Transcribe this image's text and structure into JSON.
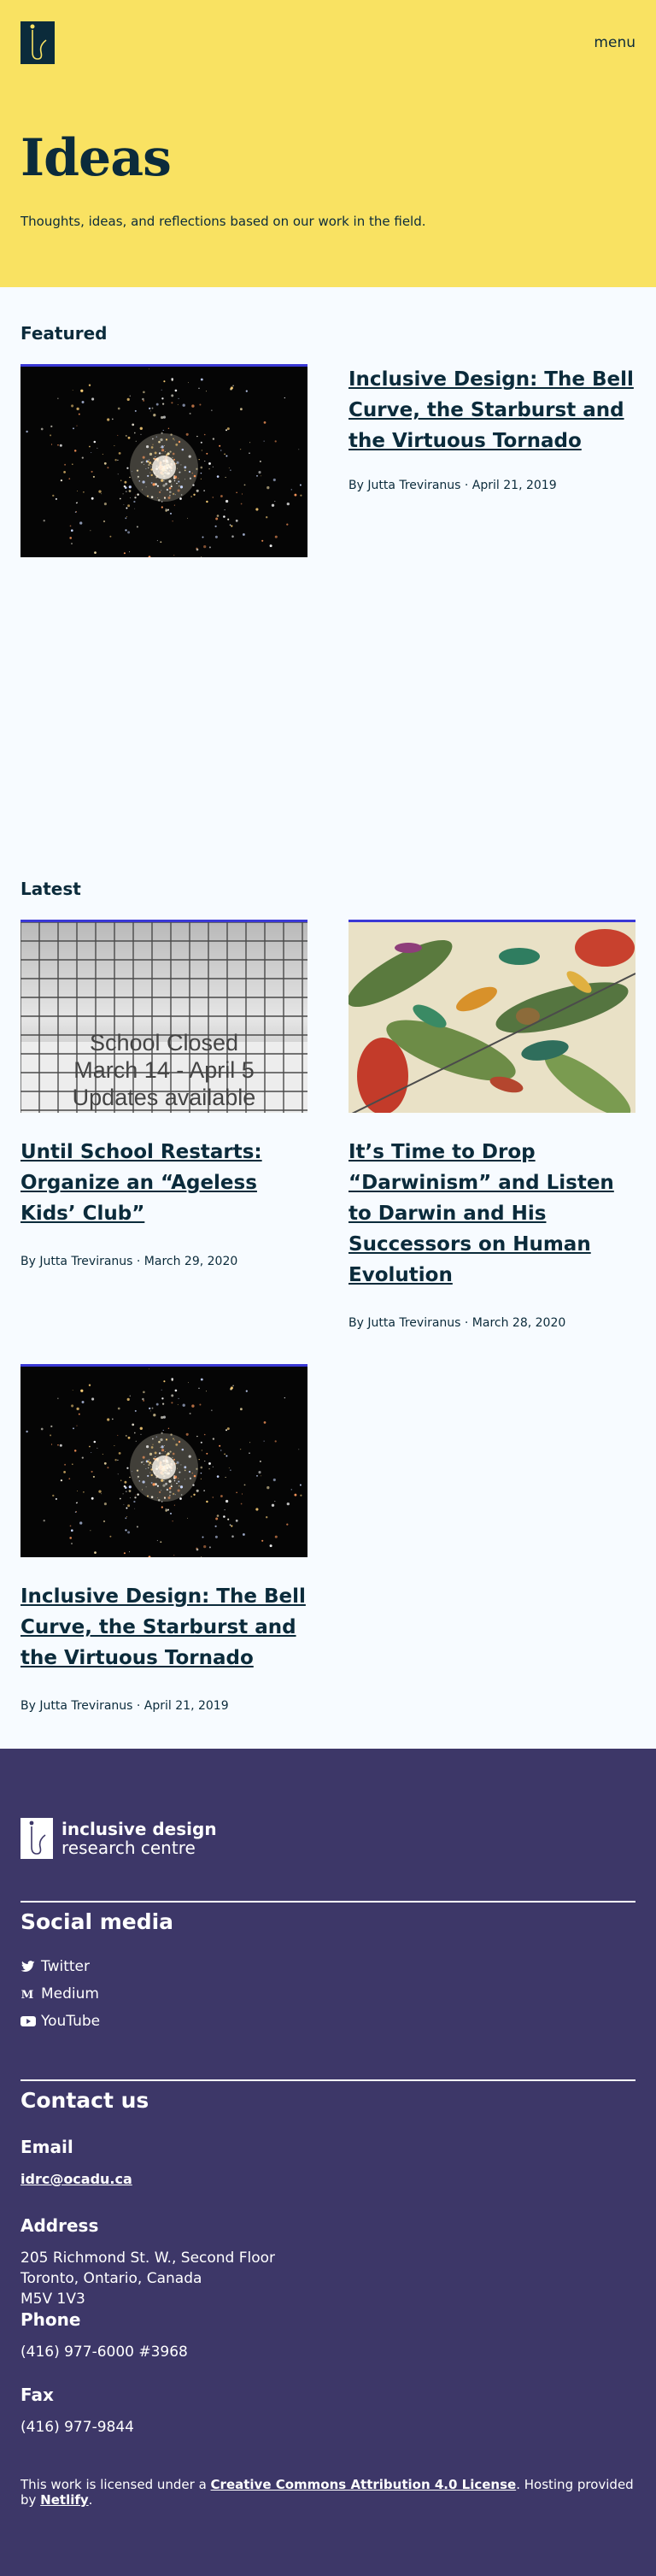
{
  "header": {
    "logo_alt": "IDRC logo",
    "menu_label": "menu",
    "title": "Ideas",
    "subtitle": "Thoughts, ideas, and reflections based on our work in the field."
  },
  "featured": {
    "heading": "Featured",
    "post": {
      "title": "Inclusive Design: The Bell Curve, the Starburst and the Virtuous Tornado",
      "meta": "By Jutta Treviranus · April 21, 2019",
      "image": "star-cluster"
    }
  },
  "latest": {
    "heading": "Latest",
    "posts": [
      {
        "title": "Until School Restarts: Organize an “Ageless Kids’ Club”",
        "meta": "By Jutta Treviranus · March 29, 2020",
        "image": "school-closed-sign",
        "sign_lines": [
          "School Closed",
          "March 14 - April 5",
          "Updates available"
        ]
      },
      {
        "title": "It’s Time to Drop “Darwinism” and Listen to Darwin and His Successors on Human Evolution",
        "meta": "By Jutta Treviranus · March 28, 2020",
        "image": "hummingbirds-illustration"
      },
      {
        "title": "Inclusive Design: The Bell Curve, the Starburst and the Virtuous Tornado",
        "meta": "By Jutta Treviranus · April 21, 2019",
        "image": "star-cluster"
      }
    ]
  },
  "footer": {
    "logo_line1": "inclusive design",
    "logo_line2": "research centre",
    "social_heading": "Social media",
    "social": [
      {
        "label": "Twitter",
        "icon": "twitter-icon"
      },
      {
        "label": "Medium",
        "icon": "medium-icon"
      },
      {
        "label": "YouTube",
        "icon": "youtube-icon"
      }
    ],
    "contact_heading": "Contact us",
    "email_heading": "Email",
    "email": "idrc@ocadu.ca",
    "address_heading": "Address",
    "address_lines": [
      "205 Richmond St. W., Second Floor",
      "Toronto, Ontario, Canada",
      "M5V 1V3"
    ],
    "phone_heading": "Phone",
    "phone": "(416) 977-6000 #3968",
    "fax_heading": "Fax",
    "fax": "(416) 977-9844",
    "license_prefix": "This work is licensed under a ",
    "license_link": "Creative Commons Attribution 4.0 License",
    "license_mid": ". Hosting provided by ",
    "host_link": "Netlify",
    "license_suffix": "."
  },
  "colors": {
    "hero_bg": "#f9e262",
    "page_bg": "#f7fbff",
    "text": "#0b2b3b",
    "footer_bg": "#3d3768",
    "image_accent": "#3a38d6"
  }
}
